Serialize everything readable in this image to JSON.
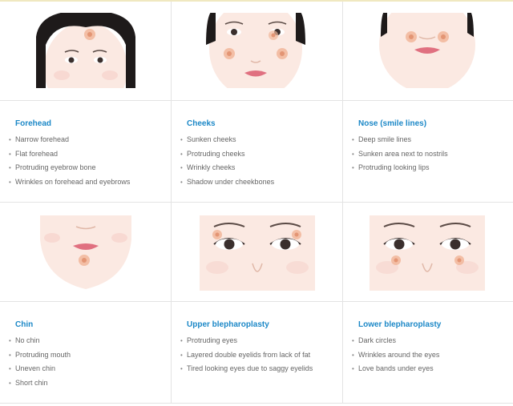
{
  "panels": [
    {
      "title": "Forehead",
      "items": [
        "Narrow forehead",
        "Flat forehead",
        "Protruding eyebrow bone",
        "Wrinkles on forehead and eyebrows"
      ]
    },
    {
      "title": "Cheeks",
      "items": [
        "Sunken cheeks",
        "Protruding cheeks",
        "Wrinkly cheeks",
        "Shadow under cheekbones"
      ]
    },
    {
      "title": "Nose (smile lines)",
      "items": [
        "Deep smile lines",
        "Sunken area next to nostrils",
        "Protruding looking lips"
      ]
    },
    {
      "title": "Chin",
      "items": [
        "No chin",
        "Protruding mouth",
        "Uneven chin",
        "Short chin"
      ]
    },
    {
      "title": "Upper blepharoplasty",
      "items": [
        "Protruding eyes",
        "Layered double eyelids from lack of fat",
        "Tired looking eyes due to saggy eyelids"
      ]
    },
    {
      "title": "Lower blepharoplasty",
      "items": [
        "Dark circles",
        "Wrinkles around the eyes",
        "Love bands under eyes"
      ]
    }
  ],
  "colors": {
    "heading": "#1c88c7",
    "marker": "#e8a080",
    "lips": "#e07080",
    "skin": "#fbe9e2"
  },
  "icons": [
    "forehead-face-illustration",
    "cheeks-face-illustration",
    "nose-face-illustration",
    "chin-face-illustration",
    "upper-eye-face-illustration",
    "lower-eye-face-illustration"
  ]
}
